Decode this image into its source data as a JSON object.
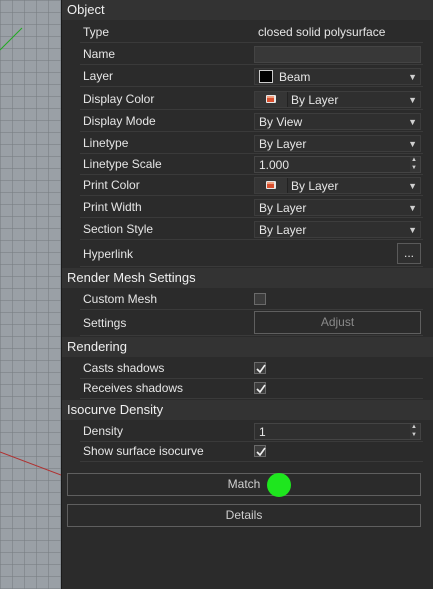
{
  "sections": {
    "object": "Object",
    "render_mesh": "Render Mesh Settings",
    "rendering": "Rendering",
    "isocurve": "Isocurve Density"
  },
  "object": {
    "type_label": "Type",
    "type_value": "closed solid polysurface",
    "name_label": "Name",
    "name_value": "",
    "layer_label": "Layer",
    "layer_value": "Beam",
    "display_color_label": "Display Color",
    "display_color_value": "By Layer",
    "display_mode_label": "Display Mode",
    "display_mode_value": "By View",
    "linetype_label": "Linetype",
    "linetype_value": "By Layer",
    "linetype_scale_label": "Linetype Scale",
    "linetype_scale_value": "1.000",
    "print_color_label": "Print Color",
    "print_color_value": "By Layer",
    "print_width_label": "Print Width",
    "print_width_value": "By Layer",
    "section_style_label": "Section Style",
    "section_style_value": "By Layer",
    "hyperlink_label": "Hyperlink",
    "hyperlink_button": "..."
  },
  "render_mesh": {
    "custom_mesh_label": "Custom Mesh",
    "custom_mesh_checked": false,
    "settings_label": "Settings",
    "adjust_button": "Adjust"
  },
  "rendering": {
    "casts_shadows_label": "Casts shadows",
    "casts_shadows_checked": true,
    "receives_shadows_label": "Receives shadows",
    "receives_shadows_checked": true
  },
  "isocurve": {
    "density_label": "Density",
    "density_value": "1",
    "show_surface_label": "Show surface isocurve",
    "show_surface_checked": true
  },
  "buttons": {
    "match": "Match",
    "details": "Details"
  },
  "colors": {
    "panel_bg": "#2b2b2b",
    "header_bg": "#333333",
    "viewport_bg": "#9aa0a6",
    "indicator": "#1ee61e",
    "layer_swatch": "#000000"
  },
  "icons": {
    "dropdown": "chevron-down-icon",
    "color_picker": "color-picker-icon",
    "checkbox_check": "check-icon",
    "spin": "spin-updown-icon"
  }
}
